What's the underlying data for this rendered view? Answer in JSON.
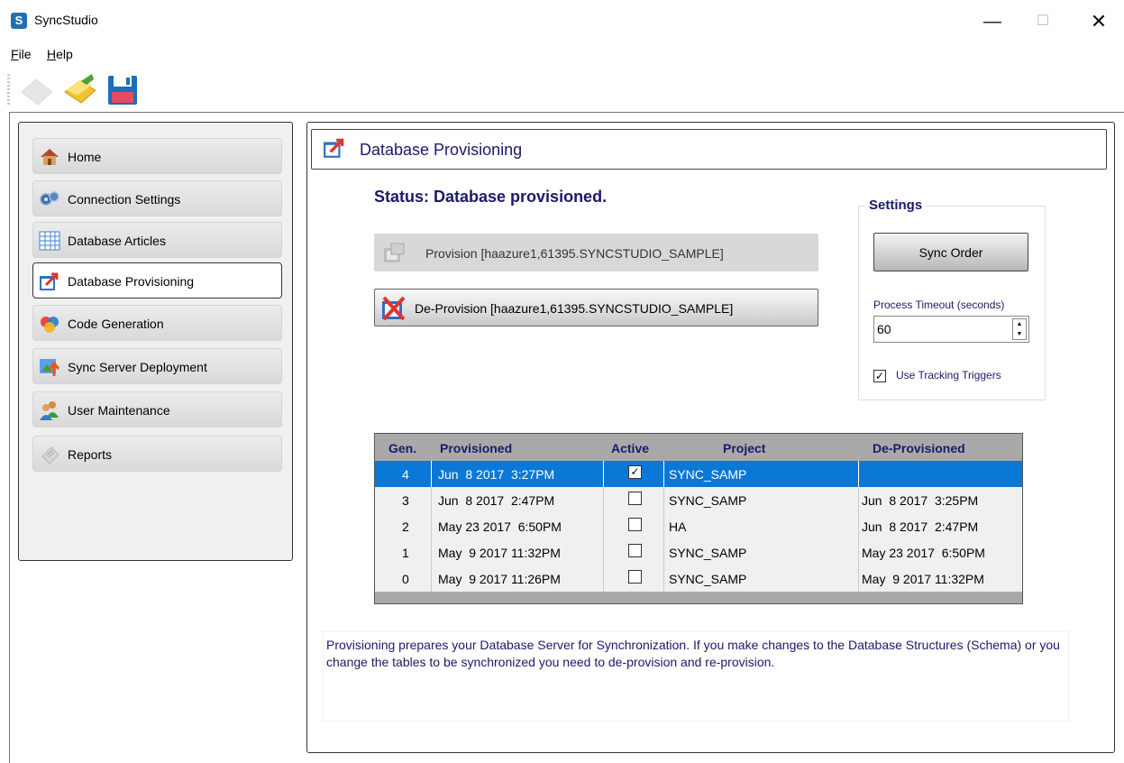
{
  "window": {
    "app_icon_letter": "S",
    "title": "SyncStudio",
    "minimize": "—",
    "maximize": "☐",
    "close": "✕"
  },
  "menu": {
    "file": "File",
    "help": "Help"
  },
  "toolbar": {
    "buttons": [
      "new-icon",
      "open-folder-icon",
      "save-disk-icon"
    ]
  },
  "sidebar": {
    "items": [
      {
        "label": "Home",
        "icon": "house-icon"
      },
      {
        "label": "Connection Settings",
        "icon": "gears-icon"
      },
      {
        "label": "Database Articles",
        "icon": "table-grid-icon"
      },
      {
        "label": "Database Provisioning",
        "icon": "provisioning-icon",
        "active": true
      },
      {
        "label": "Code Generation",
        "icon": "code-generation-icon"
      },
      {
        "label": "Sync Server Deployment",
        "icon": "deployment-icon"
      },
      {
        "label": "User Maintenance",
        "icon": "users-icon"
      },
      {
        "label": "Reports",
        "icon": "reports-icon"
      }
    ]
  },
  "content": {
    "header_title": "Database Provisioning",
    "status": "Status: Database provisioned.",
    "provision_label": "Provision  [haazure1,61395.SYNCSTUDIO_SAMPLE]",
    "deprovision_label": "De-Provision  [haazure1,61395.SYNCSTUDIO_SAMPLE]",
    "description": "Provisioning prepares your Database Server for Synchronization. If you make changes to the Database Structures (Schema) or you change the tables to be synchronized you need to de-provision and re-provision."
  },
  "settings": {
    "legend": "Settings",
    "sync_order": "Sync Order",
    "timeout_label": "Process Timeout (seconds)",
    "timeout_value": "60",
    "use_tracking_triggers": "Use Tracking Triggers",
    "use_tracking_checked": true
  },
  "grid": {
    "columns": [
      "Gen.",
      "Provisioned",
      "Active",
      "Project",
      "De-Provisioned"
    ],
    "rows": [
      {
        "gen": "4",
        "provisioned": "Jun  8 2017  3:27PM",
        "active": true,
        "project": "SYNC_SAMP",
        "deprovisioned": "",
        "selected": true
      },
      {
        "gen": "3",
        "provisioned": "Jun  8 2017  2:47PM",
        "active": false,
        "project": "SYNC_SAMP",
        "deprovisioned": "Jun  8 2017  3:25PM"
      },
      {
        "gen": "2",
        "provisioned": "May 23 2017  6:50PM",
        "active": false,
        "project": "HA",
        "deprovisioned": "Jun  8 2017  2:47PM"
      },
      {
        "gen": "1",
        "provisioned": "May  9 2017 11:32PM",
        "active": false,
        "project": "SYNC_SAMP",
        "deprovisioned": "May 23 2017  6:50PM"
      },
      {
        "gen": "0",
        "provisioned": "May  9 2017 11:26PM",
        "active": false,
        "project": "SYNC_SAMP",
        "deprovisioned": "May  9 2017 11:32PM"
      }
    ]
  },
  "colors": {
    "accent_text": "#1a1a6a",
    "selection": "#0a78d7"
  }
}
